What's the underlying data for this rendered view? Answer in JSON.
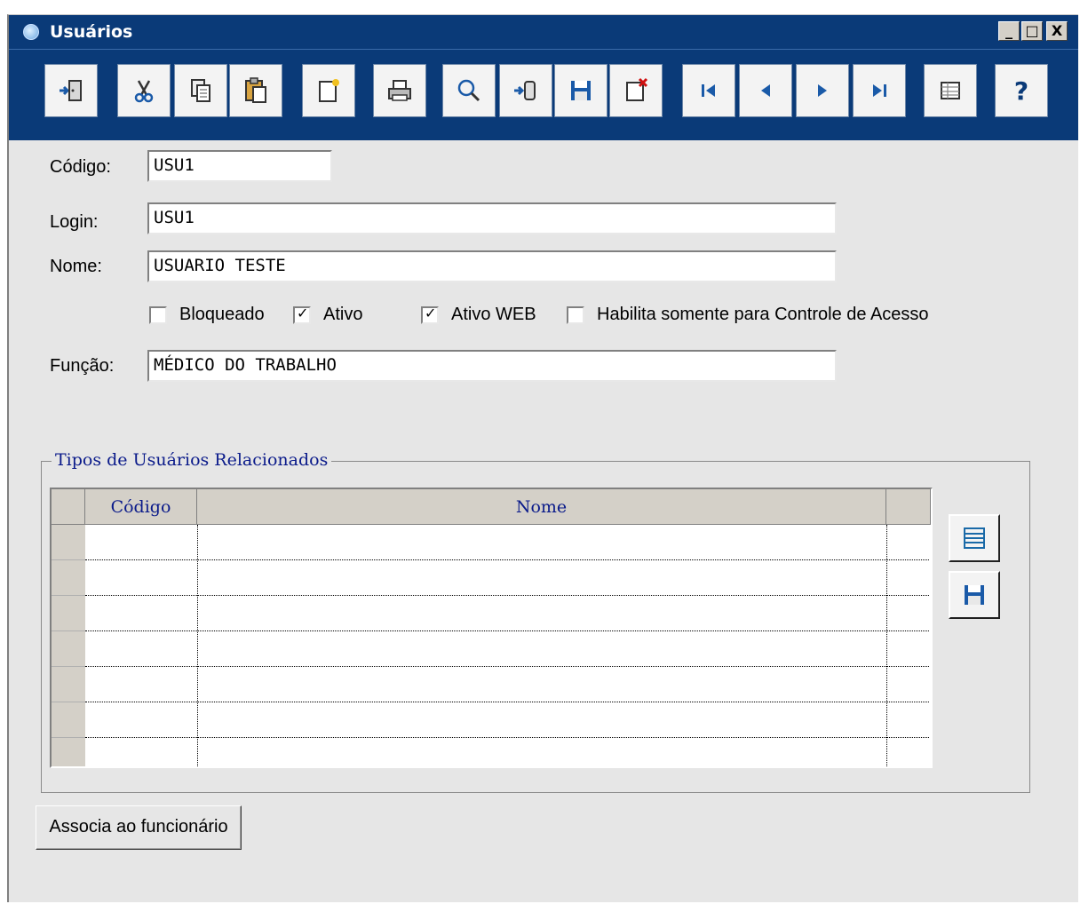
{
  "window": {
    "title": "Usuários",
    "minimize": "_",
    "maximize": "□",
    "close": "X"
  },
  "toolbar": {
    "buttons": [
      "exit",
      "cut",
      "copy",
      "paste",
      "new",
      "print",
      "search",
      "import",
      "save",
      "delete",
      "first",
      "previous",
      "next",
      "last",
      "grid-view",
      "help"
    ],
    "help_label": "?"
  },
  "form": {
    "codigo_label": "Código:",
    "codigo_value": "USU1",
    "login_label": "Login:",
    "login_value": "USU1",
    "nome_label": "Nome:",
    "nome_value": "USUARIO TESTE",
    "funcao_label": "Função:",
    "funcao_value": "MÉDICO DO TRABALHO",
    "checkboxes": [
      {
        "label": "Bloqueado",
        "checked": false
      },
      {
        "label": "Ativo",
        "checked": true
      },
      {
        "label": "Ativo WEB",
        "checked": true
      },
      {
        "label": "Habilita somente para Controle de Acesso",
        "checked": false
      }
    ]
  },
  "related_types": {
    "title": "Tipos de Usuários Relacionados",
    "columns": [
      "Código",
      "Nome"
    ],
    "rows": 7
  },
  "actions": {
    "associate_label": "Associa ao funcionário"
  },
  "colors": {
    "titlebar": "#0a3a78",
    "window_bg": "#e6e6e6",
    "grid_header_text": "#0a1a8a"
  }
}
